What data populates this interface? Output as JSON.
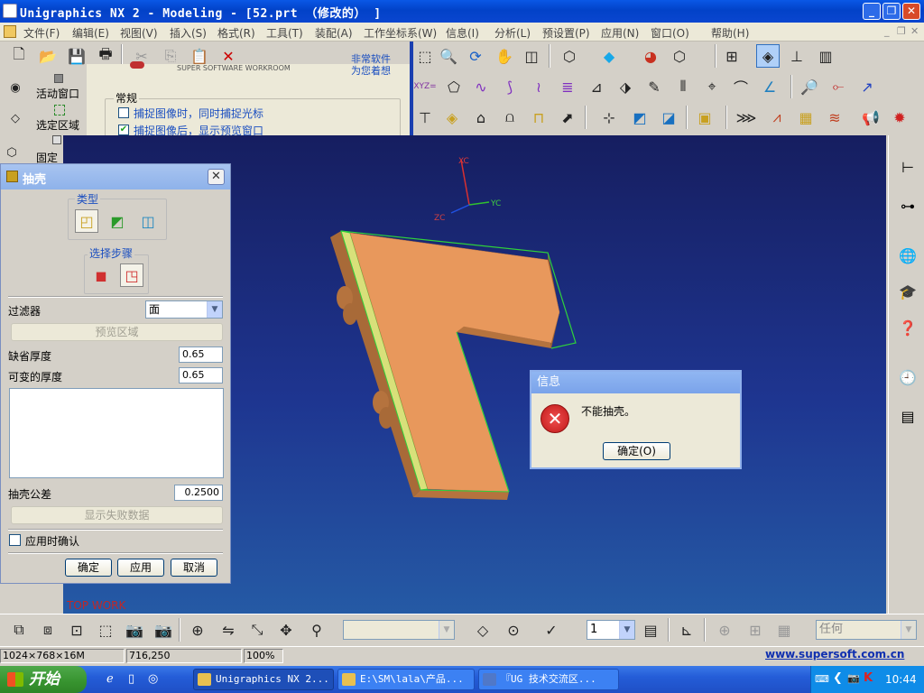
{
  "window": {
    "title": "Unigraphics NX 2 - Modeling - [52.prt （修改的） ]"
  },
  "menu": [
    "文件(F)",
    "编辑(E)",
    "视图(V)",
    "插入(S)",
    "格式(R)",
    "工具(T)",
    "装配(A)",
    "工作坐标系(W)",
    "信息(I)",
    "分析(L)",
    "预设置(P)",
    "应用(N)",
    "窗口(O)",
    "帮助(H)"
  ],
  "left_strip": {
    "active_window": "活动窗口",
    "select_area": "选定区域",
    "fixed": "固定"
  },
  "banner": {
    "line1": "非常软件",
    "line2": "为您着想",
    "partial": "SUPER SOFTWARE WORKROOM"
  },
  "regular_group": {
    "title": "常规",
    "opt1": "捕捉图像时，同时捕捉光标",
    "opt1_checked": false,
    "opt2": "捕捉图像后，显示预览窗口",
    "opt2_checked": true
  },
  "viewport": {
    "axis_xc": "XC",
    "axis_yc": "YC",
    "axis_zc": "ZC",
    "watermark": "TOP WORK"
  },
  "shell_dialog": {
    "title": "抽壳",
    "type_label": "类型",
    "steps_label": "选择步骤",
    "filter_label": "过滤器",
    "filter_value": "面",
    "preview_area": "预览区域",
    "default_thickness_label": "缺省厚度",
    "default_thickness_value": "0.65",
    "variable_thickness_label": "可变的厚度",
    "variable_thickness_value": "0.65",
    "tolerance_label": "抽壳公差",
    "tolerance_value": "0.2500",
    "show_failure": "显示失败数据",
    "confirm_on_apply": "应用时确认",
    "confirm_on_apply_checked": false,
    "ok": "确定",
    "apply": "应用",
    "cancel": "取消"
  },
  "message_box": {
    "title": "信息",
    "message": "不能抽壳。",
    "ok": "确定(O)"
  },
  "bottom_toolbar": {
    "layer_value": "1",
    "snap_value": "任何"
  },
  "status": {
    "resolution": "1024×768×16M",
    "coords": "716,250",
    "zoom": "100%",
    "website": "www.supersoft.com.cn"
  },
  "taskbar": {
    "start": "开始",
    "tasks": [
      "Unigraphics NX 2...",
      "E:\\SM\\lala\\产品...",
      "『UG 技术交流区..."
    ],
    "clock": "10:44"
  },
  "colors": {
    "part": "#e8985c",
    "edge": "#2fd23a",
    "titlebar": "#0a58e6",
    "viewport_top": "#161e60",
    "viewport_bottom": "#255aa5"
  }
}
